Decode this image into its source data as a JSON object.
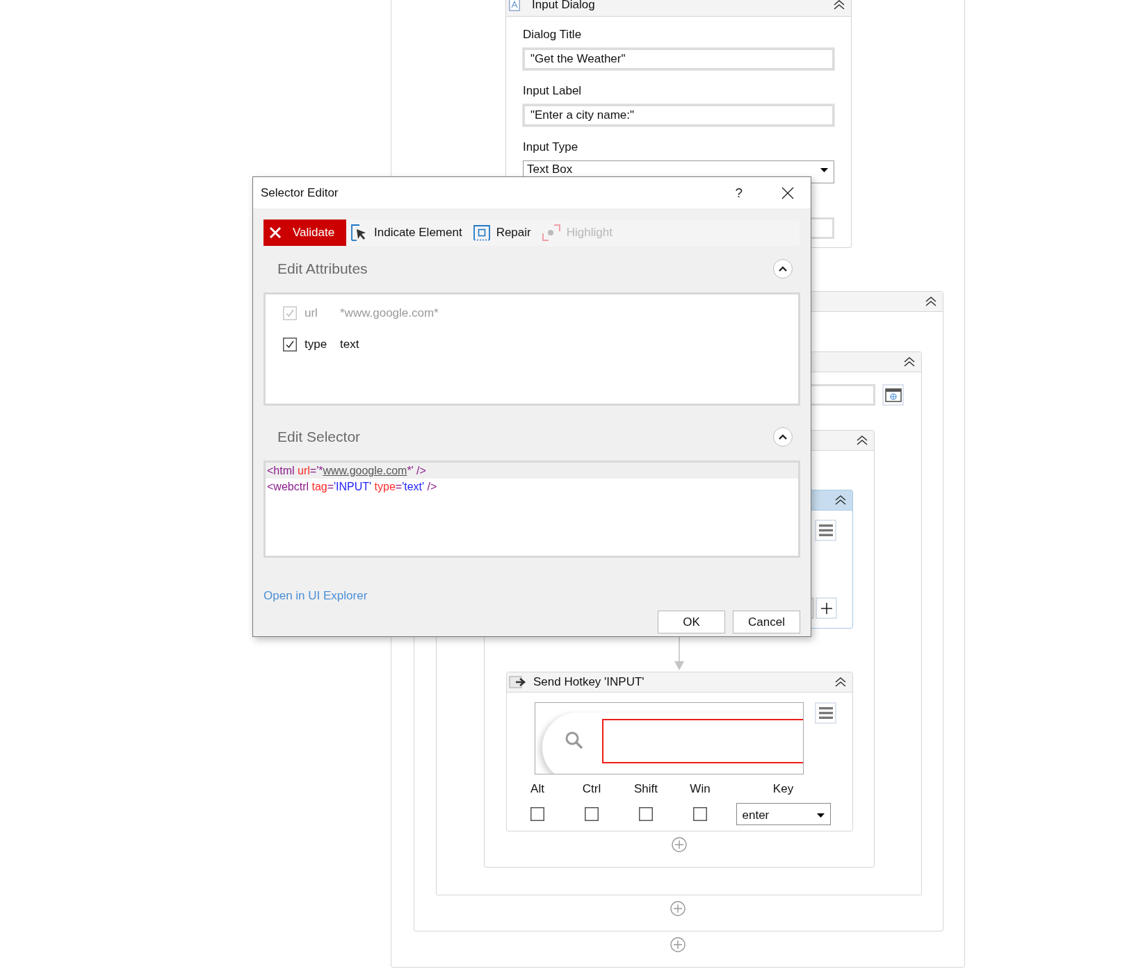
{
  "input_dialog": {
    "title": "Input Dialog",
    "fields": [
      {
        "label": "Dialog Title",
        "value": "\"Get the Weather\"",
        "kind": "text"
      },
      {
        "label": "Input Label",
        "value": "\"Enter a city name:\"",
        "kind": "text"
      },
      {
        "label": "Input Type",
        "value": "Text Box",
        "kind": "dropdown"
      }
    ]
  },
  "send_hotkey": {
    "title": "Send Hotkey 'INPUT'",
    "modifiers": [
      {
        "label": "Alt",
        "checked": false
      },
      {
        "label": "Ctrl",
        "checked": false
      },
      {
        "label": "Shift",
        "checked": false
      },
      {
        "label": "Win",
        "checked": false
      }
    ],
    "key": {
      "label": "Key",
      "value": "enter"
    }
  },
  "selector_editor": {
    "title": "Selector Editor",
    "help": "?",
    "toolbar": [
      {
        "kind": "validate",
        "label": "Validate",
        "disabled": false
      },
      {
        "kind": "indicate",
        "label": "Indicate Element",
        "disabled": false
      },
      {
        "kind": "repair",
        "label": "Repair",
        "disabled": false
      },
      {
        "kind": "highlight",
        "label": "Highlight",
        "disabled": true
      }
    ],
    "attributes_section": {
      "title": "Edit Attributes",
      "expanded": true
    },
    "attributes": [
      {
        "name": "url",
        "value": "*www.google.com*",
        "checked": true,
        "disabled": true
      },
      {
        "name": "type",
        "value": "text",
        "checked": true,
        "disabled": false
      }
    ],
    "selector_section": {
      "title": "Edit Selector",
      "expanded": true
    },
    "selector_lines": [
      {
        "selected": true,
        "tokens": [
          {
            "kind": "tag",
            "text": "<html"
          },
          {
            "kind": "attr",
            "text": " url"
          },
          {
            "kind": "punct",
            "text": "='*"
          },
          {
            "kind": "link",
            "text": "www.google.com"
          },
          {
            "kind": "punct",
            "text": "*' />"
          }
        ]
      },
      {
        "selected": false,
        "tokens": [
          {
            "kind": "tag",
            "text": "<webctrl"
          },
          {
            "kind": "attr",
            "text": " tag"
          },
          {
            "kind": "punct",
            "text": "="
          },
          {
            "kind": "value",
            "text": "'INPUT'"
          },
          {
            "kind": "attr",
            "text": " type"
          },
          {
            "kind": "punct",
            "text": "="
          },
          {
            "kind": "value",
            "text": "'text'"
          },
          {
            "kind": "punct",
            "text": " />"
          }
        ]
      }
    ],
    "link": "Open in UI Explorer",
    "buttons": [
      {
        "label": "OK"
      },
      {
        "label": "Cancel"
      }
    ]
  }
}
